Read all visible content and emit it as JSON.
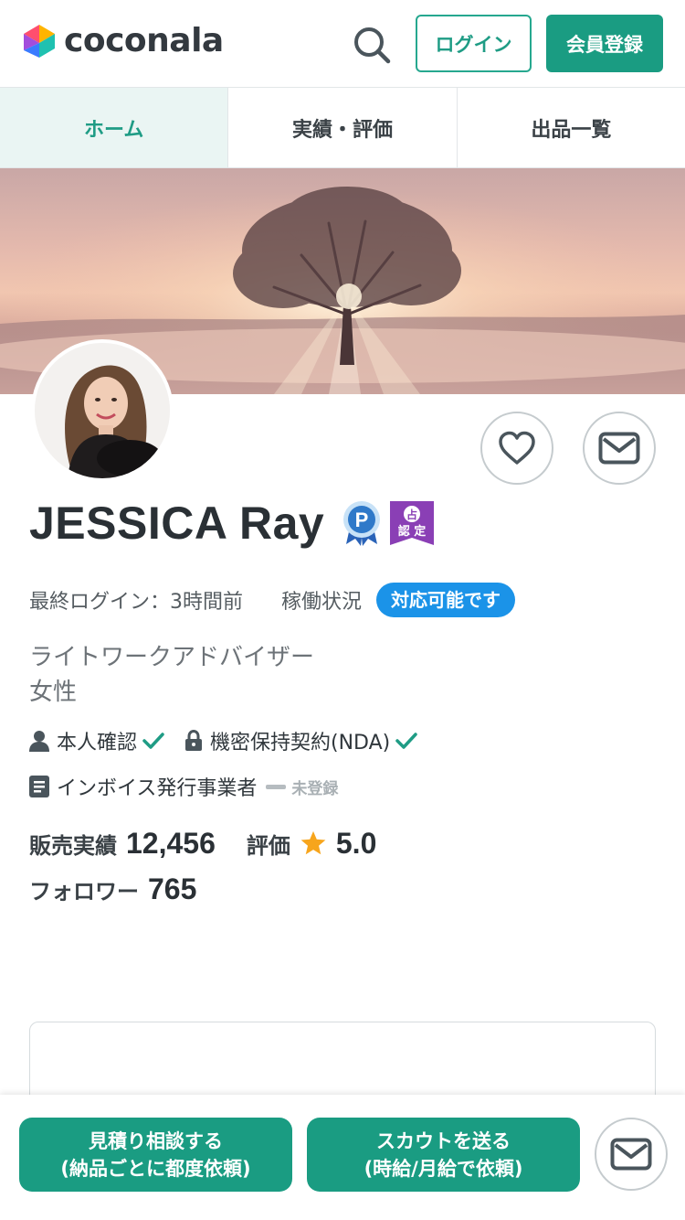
{
  "header": {
    "logo_text": "coconala",
    "login_label": "ログイン",
    "register_label": "会員登録"
  },
  "tabs": [
    {
      "label": "ホーム",
      "active": true
    },
    {
      "label": "実績・評価",
      "active": false
    },
    {
      "label": "出品一覧",
      "active": false
    }
  ],
  "profile": {
    "name": "JESSICA Ray",
    "badge_certified": "占\n認定",
    "last_login": "最終ログイン：3時間前",
    "status_label": "稼働状況",
    "status_value": "対応可能です",
    "job": "ライトワークアドバイザー",
    "gender": "女性",
    "identity_verified": "本人確認",
    "nda": "機密保持契約(NDA)",
    "invoice": "インボイス発行事業者",
    "invoice_status": "未登録",
    "sales_label": "販売実績",
    "sales_value": "12,456",
    "rating_label": "評価",
    "rating_value": "5.0",
    "followers_label": "フォロワー",
    "followers_value": "765"
  },
  "bottom_bar": {
    "cta1_line1": "見積り相談する",
    "cta1_line2": "(納品ごとに都度依頼)",
    "cta2_line1": "スカウトを送る",
    "cta2_line2": "(時給/月給で依頼)"
  },
  "colors": {
    "brand": "#1a9c82",
    "status_blue": "#1b93e8",
    "star": "#f7a51c",
    "badge_p": "#2f79c9",
    "badge_cert": "#8a3fb5"
  }
}
